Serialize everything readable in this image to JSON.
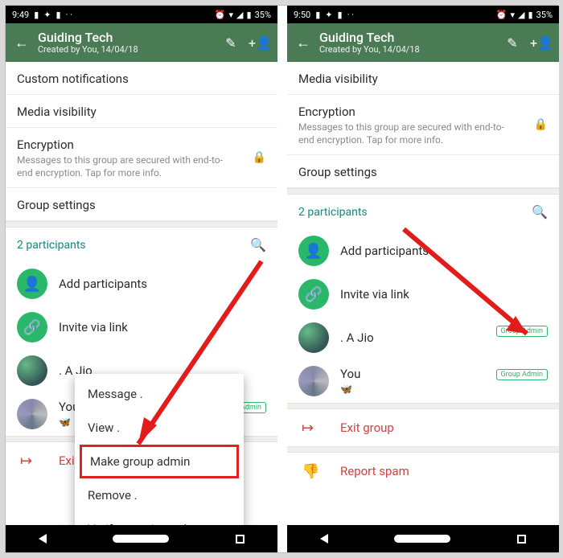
{
  "status": {
    "time_left": "9:49",
    "time_right": "9:50",
    "battery": "35%"
  },
  "appbar": {
    "title": "Guiding Tech",
    "subtitle": "Created by You, 14/04/18"
  },
  "rows": {
    "custom_notifications": "Custom notifications",
    "media_visibility": "Media visibility",
    "encryption": "Encryption",
    "encryption_sub": "Messages to this group are secured with end-to-end encryption. Tap for more info.",
    "group_settings": "Group settings"
  },
  "participants": {
    "header": "2 participants",
    "add": "Add participants",
    "invite": "Invite via link",
    "p1": ". A Jio",
    "p2": "You",
    "p2_emoji": "🦋",
    "badge": "Group Admin"
  },
  "actions": {
    "exit": "Exit group",
    "exit_short": "Exit g",
    "report": "Report spam"
  },
  "popup": {
    "message": "Message .",
    "view": "View .",
    "make_admin": "Make group admin",
    "remove": "Remove .",
    "verify": "Verify security code"
  }
}
